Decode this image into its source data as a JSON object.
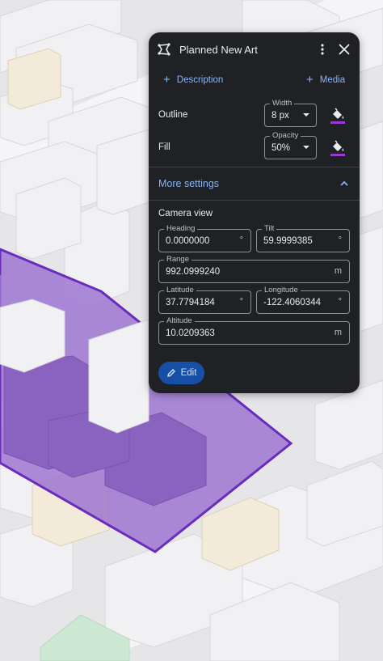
{
  "panel": {
    "title": "Planned New Art",
    "add_description": "Description",
    "add_media": "Media",
    "outline": {
      "label": "Outline",
      "width_legend": "Width",
      "width_value": "8 px"
    },
    "fill": {
      "label": "Fill",
      "opacity_legend": "Opacity",
      "opacity_value": "50%"
    },
    "more_settings": "More settings",
    "camera_view": {
      "heading_label": "Camera view",
      "heading": {
        "legend": "Heading",
        "value": "0.0000000",
        "unit": "°"
      },
      "tilt": {
        "legend": "Tilt",
        "value": "59.9999385",
        "unit": "°"
      },
      "range": {
        "legend": "Range",
        "value": "992.0999240",
        "unit": "m"
      },
      "latitude": {
        "legend": "Latitude",
        "value": "37.7794184",
        "unit": "°"
      },
      "longitude": {
        "legend": "Longitude",
        "value": "-122.4060344",
        "unit": "°"
      },
      "altitude": {
        "legend": "Altitude",
        "value": "10.0209363",
        "unit": "m"
      }
    },
    "edit_label": "Edit"
  },
  "colors": {
    "panel_bg": "#202124",
    "accent": "#8ab4f8",
    "polygon_fill": "#9b72cf",
    "polygon_outline": "#6a2bbf",
    "edit_button": "#174ea6"
  },
  "icons": [
    "polygon-shape-icon",
    "more-vert-icon",
    "close-icon",
    "add-icon",
    "fill-bucket-icon",
    "chevron-up-icon",
    "pencil-icon"
  ]
}
